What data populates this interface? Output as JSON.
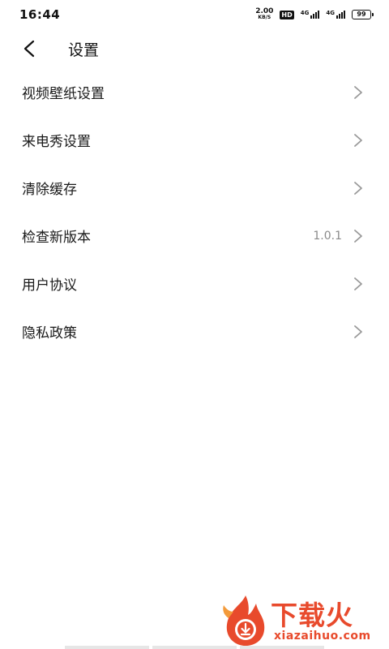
{
  "status_bar": {
    "time": "16:44",
    "net_speed_value": "2.00",
    "net_speed_unit": "KB/S",
    "hd_badge": "HD",
    "sim1_tag": "4G",
    "sim2_tag": "4G",
    "battery_level": "99"
  },
  "header": {
    "title": "设置"
  },
  "settings": {
    "items": [
      {
        "label": "视频壁纸设置",
        "value": ""
      },
      {
        "label": "来电秀设置",
        "value": ""
      },
      {
        "label": "清除缓存",
        "value": ""
      },
      {
        "label": "检查新版本",
        "value": "1.0.1"
      },
      {
        "label": "用户协议",
        "value": ""
      },
      {
        "label": "隐私政策",
        "value": ""
      }
    ]
  },
  "watermark": {
    "brand": "下载火",
    "domain": "xiazaihuo.com"
  },
  "colors": {
    "background": "#ffffff",
    "text": "#1a1a1a",
    "secondary_text": "#8a8a8a",
    "chevron": "#999999",
    "watermark": "#e84a2c"
  }
}
